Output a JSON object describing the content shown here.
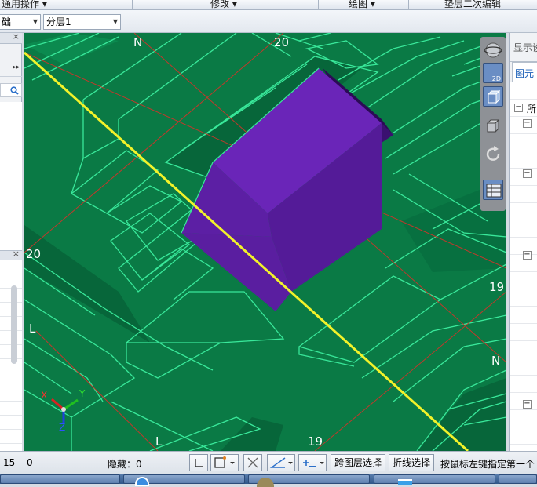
{
  "menubar": {
    "groups": [
      "通用操作 ▾",
      "修改 ▾",
      "绘图 ▾",
      "垫层二次编辑"
    ]
  },
  "toolbar": {
    "combo1_value": "础",
    "combo2_value": "分层1"
  },
  "left_panel": {
    "search_icon": "search-icon",
    "expand_icon": "double-arrow-icon"
  },
  "right_panel": {
    "tab_display": "显示设",
    "tab_layers": "图元",
    "tree_root": "所"
  },
  "viewport": {
    "axis_labels": {
      "top_n": "N",
      "top_20": "20",
      "left_20": "20",
      "left_l": "L",
      "right_19": "19",
      "right_n": "N",
      "bottom_l": "L",
      "bottom_19": "19"
    },
    "gizmo": {
      "x": "X",
      "y": "Y",
      "z": "Z"
    },
    "colors": {
      "background": "#0a7a45",
      "outline": "#39e89a",
      "object": "#5b1aa0",
      "axis_line": "#ffff33"
    }
  },
  "navbar": {
    "mode_2d_label": "2D"
  },
  "statusbar": {
    "value1": "15",
    "value2": "0",
    "hidden_label": "隐藏：0",
    "cross_layer_btn": "跨图层选择",
    "polyline_btn": "折线选择",
    "hint": "按鼠标左键指定第一个"
  }
}
